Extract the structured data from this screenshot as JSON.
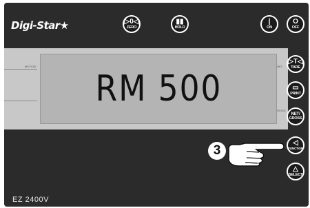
{
  "brand": {
    "logo_text": "Digi-Star"
  },
  "top_buttons": [
    {
      "symbol": "▷0◁",
      "label": "ZERO"
    },
    {
      "symbol": "▮▮",
      "label": "HOLD"
    },
    {
      "symbol": "|",
      "label": "ON"
    },
    {
      "symbol": "O",
      "label": "OFF"
    }
  ],
  "side_buttons": [
    {
      "symbol": "▷T◁",
      "label": "TARE"
    },
    {
      "symbol": "▭",
      "label": "PRINT"
    },
    {
      "symbol": "NET/",
      "label": "GROSS"
    },
    {
      "symbol": "◁",
      "label": "FUNCTION"
    },
    {
      "symbol": "△",
      "label": "SELECT"
    }
  ],
  "band_tags": [
    "MOTION",
    "NET",
    "GROSS"
  ],
  "display": {
    "text": "RM 500"
  },
  "callout": {
    "number": "3"
  },
  "model": {
    "name": "EZ 2400V"
  }
}
